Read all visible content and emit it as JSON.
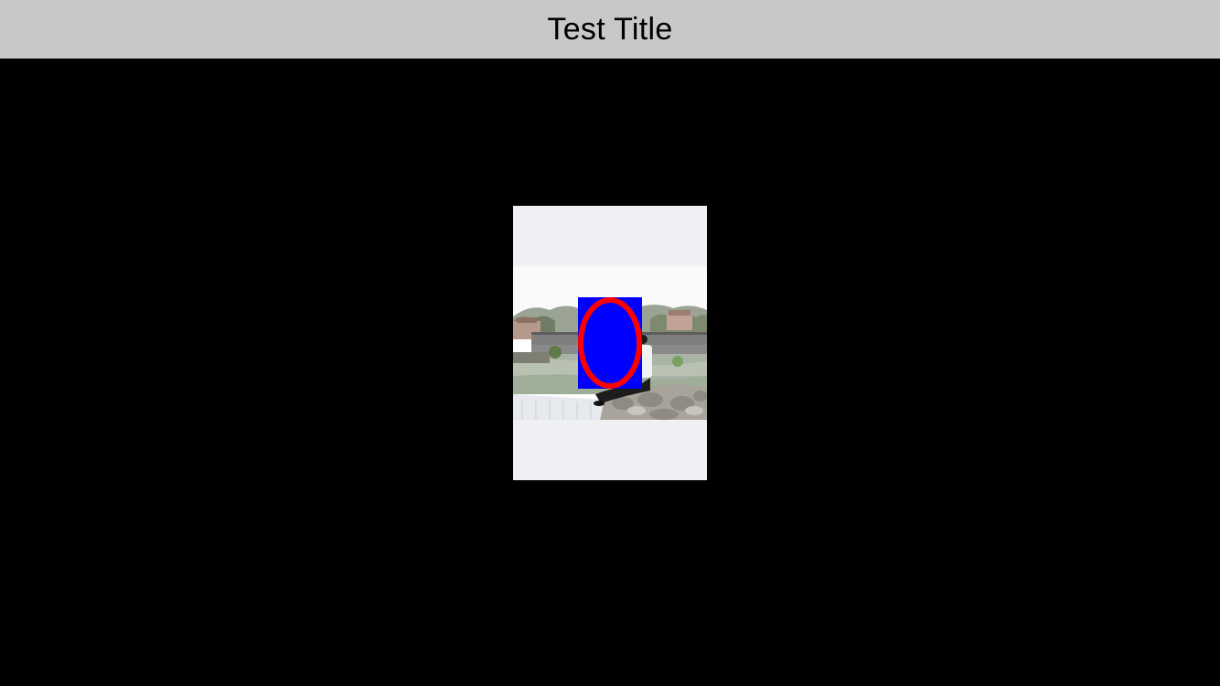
{
  "navigation": {
    "title": "Test Title"
  },
  "preview": {
    "photo": {
      "subject": "person-sitting-on-rocks-by-river-with-arched-stone-bridge"
    },
    "overlay": {
      "shape": "ellipse-in-square",
      "fill_color": "#0000ff",
      "ring_color": "#ff0000"
    }
  },
  "colors": {
    "nav_background": "#c8c8c8",
    "page_background": "#000000",
    "card_background": "#efeff4"
  }
}
